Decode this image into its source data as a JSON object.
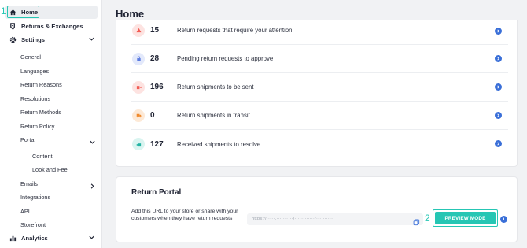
{
  "annotations": {
    "home": "1",
    "preview": "2"
  },
  "sidebar": {
    "home": "Home",
    "returns": "Returns & Exchanges",
    "settings": "Settings",
    "sub": {
      "general": "General",
      "languages": "Languages",
      "reasons": "Return Reasons",
      "resolutions": "Resolutions",
      "methods": "Return Methods",
      "policy": "Return Policy",
      "portal": "Portal",
      "content": "Content",
      "lookfeel": "Look and Feel",
      "emails": "Emails",
      "integrations": "Integrations",
      "api": "API",
      "storefront": "Storefront"
    },
    "analytics": "Analytics"
  },
  "page": {
    "title": "Home"
  },
  "stats": [
    {
      "value": "15",
      "label": "Return requests that require your attention",
      "icon": "warning-icon",
      "color": "#f25c54",
      "bg": "#fde3e1"
    },
    {
      "value": "28",
      "label": "Pending return requests to approve",
      "icon": "lock-icon",
      "color": "#5b7be0",
      "bg": "#e3e9fb"
    },
    {
      "value": "196",
      "label": "Return shipments to be sent",
      "icon": "box-out-icon",
      "color": "#f25c54",
      "bg": "#fde3e1"
    },
    {
      "value": "0",
      "label": "Return shipments in transit",
      "icon": "truck-icon",
      "color": "#f08a2c",
      "bg": "#fde9d6"
    },
    {
      "value": "127",
      "label": "Received shipments to resolve",
      "icon": "box-in-icon",
      "color": "#22b3a3",
      "bg": "#d9f4f0"
    }
  ],
  "portal": {
    "title": "Return Portal",
    "description": "Add this URL to your store or share with your customers when they have return requests",
    "url": "https://·····.··········/············/··········",
    "button": "PREVIEW MODE",
    "info": "i"
  },
  "colors": {
    "accent": "#26c6b4",
    "link": "#3a6fd8"
  }
}
